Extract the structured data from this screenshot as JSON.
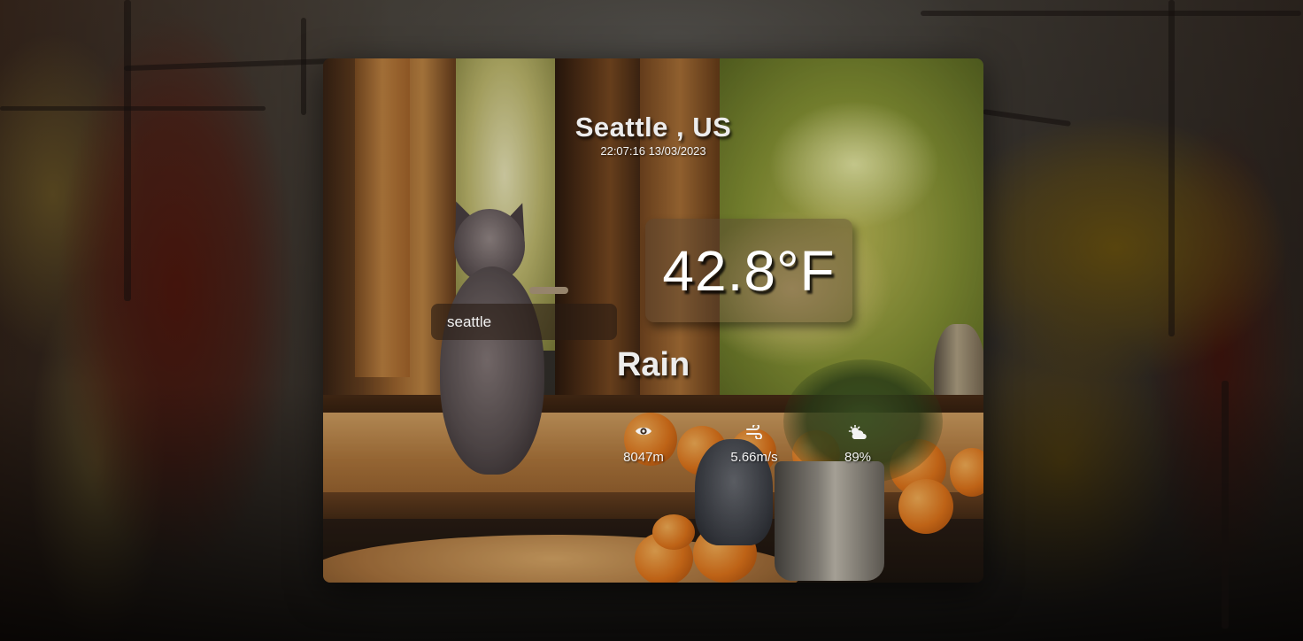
{
  "location": {
    "city_label": "Seattle , US",
    "datetime": "22:07:16 13/03/2023"
  },
  "search": {
    "value": "seattle",
    "placeholder": ""
  },
  "current": {
    "temperature": "42.8°F",
    "condition": "Rain"
  },
  "stats": [
    {
      "icon": "eye-icon",
      "value": "8047m"
    },
    {
      "icon": "wind-icon",
      "value": "5.66m/s"
    },
    {
      "icon": "cloud-sun-icon",
      "value": "89%"
    }
  ],
  "colors": {
    "text": "#ececec",
    "panel": "#5a4632"
  }
}
